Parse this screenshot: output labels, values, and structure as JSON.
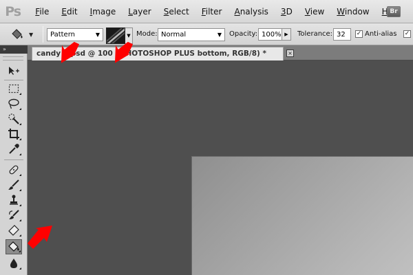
{
  "app": {
    "logo": "Ps"
  },
  "menu": [
    {
      "label": "File",
      "key": "F",
      "rest": "ile"
    },
    {
      "label": "Edit",
      "key": "E",
      "rest": "dit"
    },
    {
      "label": "Image",
      "key": "I",
      "rest": "mage"
    },
    {
      "label": "Layer",
      "key": "L",
      "rest": "ayer"
    },
    {
      "label": "Select",
      "key": "S",
      "rest": "elect"
    },
    {
      "label": "Filter",
      "key": "F",
      "rest": "ilter"
    },
    {
      "label": "Analysis",
      "key": "A",
      "rest": "nalysis"
    },
    {
      "label": "3D",
      "key": "3",
      "rest": "D"
    },
    {
      "label": "View",
      "key": "V",
      "rest": "iew"
    },
    {
      "label": "Window",
      "key": "W",
      "rest": "indow"
    },
    {
      "label": "Help",
      "key": "H",
      "rest": "elp"
    }
  ],
  "bridge_label": "Br",
  "options": {
    "fill_source": "Pattern",
    "mode_label": "Mode:",
    "mode_value": "Normal",
    "opacity_label": "Opacity:",
    "opacity_value": "100%",
    "tolerance_label": "Tolerance:",
    "tolerance_value": "32",
    "antialias_label": "Anti-alias",
    "antialias_checked": true,
    "contiguous_checked": true
  },
  "tools_panel": {
    "collapse_glyph": "»"
  },
  "document": {
    "tab_title": "candy    psd @ 100   PHOTOSHOP PLUS bottom, RGB/8) *",
    "close_glyph": "×"
  },
  "colors": {
    "annotation_arrow": "#ff0000",
    "workspace": "#4f4f4f"
  }
}
